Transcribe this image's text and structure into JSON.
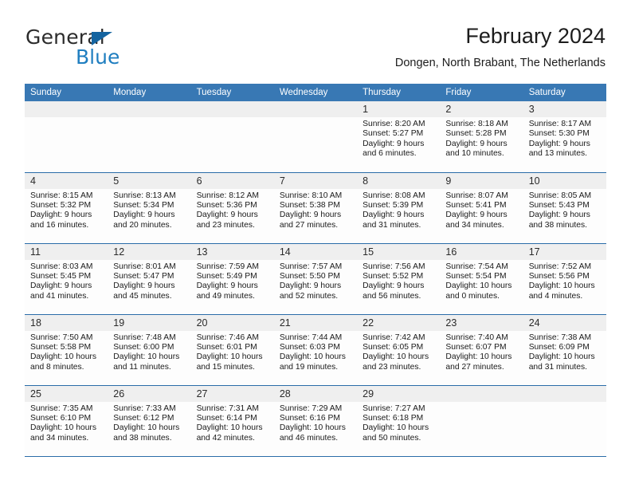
{
  "brand": {
    "word_one": "General",
    "word_two": "Blue",
    "triangle_icon": "blue-triangle-icon"
  },
  "header": {
    "title": "February 2024",
    "subtitle": "Dongen, North Brabant, The Netherlands"
  },
  "colors": {
    "header_blue": "#3878b4",
    "row_separator_blue": "#2a6ca8",
    "daynum_band": "#efefef",
    "brand_blue": "#1f7ec0"
  },
  "calendar": {
    "weekday_headers": [
      "Sunday",
      "Monday",
      "Tuesday",
      "Wednesday",
      "Thursday",
      "Friday",
      "Saturday"
    ],
    "weeks": [
      [
        {
          "day": "",
          "sunrise": "",
          "sunset": "",
          "daylight_line1": "",
          "daylight_line2": "",
          "empty": true
        },
        {
          "day": "",
          "sunrise": "",
          "sunset": "",
          "daylight_line1": "",
          "daylight_line2": "",
          "empty": true
        },
        {
          "day": "",
          "sunrise": "",
          "sunset": "",
          "daylight_line1": "",
          "daylight_line2": "",
          "empty": true
        },
        {
          "day": "",
          "sunrise": "",
          "sunset": "",
          "daylight_line1": "",
          "daylight_line2": "",
          "empty": true
        },
        {
          "day": "1",
          "sunrise": "Sunrise: 8:20 AM",
          "sunset": "Sunset: 5:27 PM",
          "daylight_line1": "Daylight: 9 hours",
          "daylight_line2": "and 6 minutes."
        },
        {
          "day": "2",
          "sunrise": "Sunrise: 8:18 AM",
          "sunset": "Sunset: 5:28 PM",
          "daylight_line1": "Daylight: 9 hours",
          "daylight_line2": "and 10 minutes."
        },
        {
          "day": "3",
          "sunrise": "Sunrise: 8:17 AM",
          "sunset": "Sunset: 5:30 PM",
          "daylight_line1": "Daylight: 9 hours",
          "daylight_line2": "and 13 minutes."
        }
      ],
      [
        {
          "day": "4",
          "sunrise": "Sunrise: 8:15 AM",
          "sunset": "Sunset: 5:32 PM",
          "daylight_line1": "Daylight: 9 hours",
          "daylight_line2": "and 16 minutes."
        },
        {
          "day": "5",
          "sunrise": "Sunrise: 8:13 AM",
          "sunset": "Sunset: 5:34 PM",
          "daylight_line1": "Daylight: 9 hours",
          "daylight_line2": "and 20 minutes."
        },
        {
          "day": "6",
          "sunrise": "Sunrise: 8:12 AM",
          "sunset": "Sunset: 5:36 PM",
          "daylight_line1": "Daylight: 9 hours",
          "daylight_line2": "and 23 minutes."
        },
        {
          "day": "7",
          "sunrise": "Sunrise: 8:10 AM",
          "sunset": "Sunset: 5:38 PM",
          "daylight_line1": "Daylight: 9 hours",
          "daylight_line2": "and 27 minutes."
        },
        {
          "day": "8",
          "sunrise": "Sunrise: 8:08 AM",
          "sunset": "Sunset: 5:39 PM",
          "daylight_line1": "Daylight: 9 hours",
          "daylight_line2": "and 31 minutes."
        },
        {
          "day": "9",
          "sunrise": "Sunrise: 8:07 AM",
          "sunset": "Sunset: 5:41 PM",
          "daylight_line1": "Daylight: 9 hours",
          "daylight_line2": "and 34 minutes."
        },
        {
          "day": "10",
          "sunrise": "Sunrise: 8:05 AM",
          "sunset": "Sunset: 5:43 PM",
          "daylight_line1": "Daylight: 9 hours",
          "daylight_line2": "and 38 minutes."
        }
      ],
      [
        {
          "day": "11",
          "sunrise": "Sunrise: 8:03 AM",
          "sunset": "Sunset: 5:45 PM",
          "daylight_line1": "Daylight: 9 hours",
          "daylight_line2": "and 41 minutes."
        },
        {
          "day": "12",
          "sunrise": "Sunrise: 8:01 AM",
          "sunset": "Sunset: 5:47 PM",
          "daylight_line1": "Daylight: 9 hours",
          "daylight_line2": "and 45 minutes."
        },
        {
          "day": "13",
          "sunrise": "Sunrise: 7:59 AM",
          "sunset": "Sunset: 5:49 PM",
          "daylight_line1": "Daylight: 9 hours",
          "daylight_line2": "and 49 minutes."
        },
        {
          "day": "14",
          "sunrise": "Sunrise: 7:57 AM",
          "sunset": "Sunset: 5:50 PM",
          "daylight_line1": "Daylight: 9 hours",
          "daylight_line2": "and 52 minutes."
        },
        {
          "day": "15",
          "sunrise": "Sunrise: 7:56 AM",
          "sunset": "Sunset: 5:52 PM",
          "daylight_line1": "Daylight: 9 hours",
          "daylight_line2": "and 56 minutes."
        },
        {
          "day": "16",
          "sunrise": "Sunrise: 7:54 AM",
          "sunset": "Sunset: 5:54 PM",
          "daylight_line1": "Daylight: 10 hours",
          "daylight_line2": "and 0 minutes."
        },
        {
          "day": "17",
          "sunrise": "Sunrise: 7:52 AM",
          "sunset": "Sunset: 5:56 PM",
          "daylight_line1": "Daylight: 10 hours",
          "daylight_line2": "and 4 minutes."
        }
      ],
      [
        {
          "day": "18",
          "sunrise": "Sunrise: 7:50 AM",
          "sunset": "Sunset: 5:58 PM",
          "daylight_line1": "Daylight: 10 hours",
          "daylight_line2": "and 8 minutes."
        },
        {
          "day": "19",
          "sunrise": "Sunrise: 7:48 AM",
          "sunset": "Sunset: 6:00 PM",
          "daylight_line1": "Daylight: 10 hours",
          "daylight_line2": "and 11 minutes."
        },
        {
          "day": "20",
          "sunrise": "Sunrise: 7:46 AM",
          "sunset": "Sunset: 6:01 PM",
          "daylight_line1": "Daylight: 10 hours",
          "daylight_line2": "and 15 minutes."
        },
        {
          "day": "21",
          "sunrise": "Sunrise: 7:44 AM",
          "sunset": "Sunset: 6:03 PM",
          "daylight_line1": "Daylight: 10 hours",
          "daylight_line2": "and 19 minutes."
        },
        {
          "day": "22",
          "sunrise": "Sunrise: 7:42 AM",
          "sunset": "Sunset: 6:05 PM",
          "daylight_line1": "Daylight: 10 hours",
          "daylight_line2": "and 23 minutes."
        },
        {
          "day": "23",
          "sunrise": "Sunrise: 7:40 AM",
          "sunset": "Sunset: 6:07 PM",
          "daylight_line1": "Daylight: 10 hours",
          "daylight_line2": "and 27 minutes."
        },
        {
          "day": "24",
          "sunrise": "Sunrise: 7:38 AM",
          "sunset": "Sunset: 6:09 PM",
          "daylight_line1": "Daylight: 10 hours",
          "daylight_line2": "and 31 minutes."
        }
      ],
      [
        {
          "day": "25",
          "sunrise": "Sunrise: 7:35 AM",
          "sunset": "Sunset: 6:10 PM",
          "daylight_line1": "Daylight: 10 hours",
          "daylight_line2": "and 34 minutes."
        },
        {
          "day": "26",
          "sunrise": "Sunrise: 7:33 AM",
          "sunset": "Sunset: 6:12 PM",
          "daylight_line1": "Daylight: 10 hours",
          "daylight_line2": "and 38 minutes."
        },
        {
          "day": "27",
          "sunrise": "Sunrise: 7:31 AM",
          "sunset": "Sunset: 6:14 PM",
          "daylight_line1": "Daylight: 10 hours",
          "daylight_line2": "and 42 minutes."
        },
        {
          "day": "28",
          "sunrise": "Sunrise: 7:29 AM",
          "sunset": "Sunset: 6:16 PM",
          "daylight_line1": "Daylight: 10 hours",
          "daylight_line2": "and 46 minutes."
        },
        {
          "day": "29",
          "sunrise": "Sunrise: 7:27 AM",
          "sunset": "Sunset: 6:18 PM",
          "daylight_line1": "Daylight: 10 hours",
          "daylight_line2": "and 50 minutes."
        },
        {
          "day": "",
          "sunrise": "",
          "sunset": "",
          "daylight_line1": "",
          "daylight_line2": "",
          "empty": true
        },
        {
          "day": "",
          "sunrise": "",
          "sunset": "",
          "daylight_line1": "",
          "daylight_line2": "",
          "empty": true
        }
      ]
    ]
  }
}
